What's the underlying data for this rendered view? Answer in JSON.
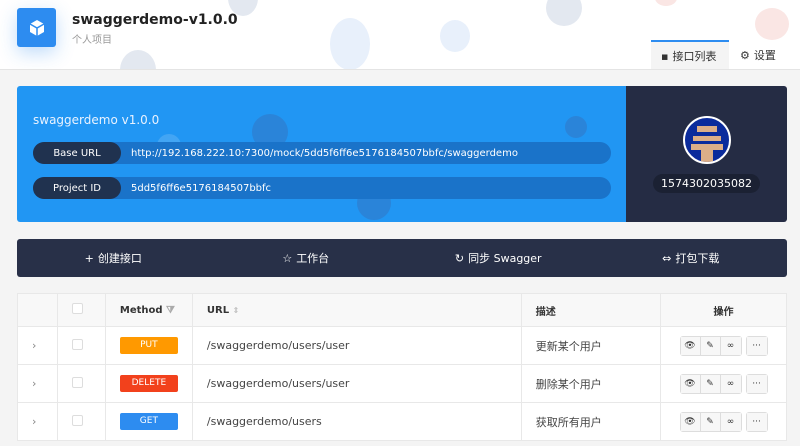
{
  "header": {
    "title": "swaggerdemo-v1.0.0",
    "subtitle": "个人项目",
    "tabs": [
      {
        "label": "接口列表",
        "icon": "list-icon"
      },
      {
        "label": "设置",
        "icon": "gear-icon"
      }
    ]
  },
  "project": {
    "name": "swaggerdemo v1.0.0",
    "base_url_label": "Base URL",
    "base_url": "http://192.168.222.10:7300/mock/5dd5f6ff6e5176184507bbfc/swaggerdemo",
    "project_id_label": "Project ID",
    "project_id": "5dd5f6ff6e5176184507bbfc"
  },
  "user": {
    "id": "1574302035082"
  },
  "actions": [
    "创建接口",
    "工作台",
    "同步 Swagger",
    "打包下载"
  ],
  "table": {
    "headers": {
      "method": "Method",
      "url": "URL",
      "desc": "描述",
      "ops": "操作"
    },
    "rows": [
      {
        "method": "PUT",
        "color": "#ff9900",
        "url": "/swaggerdemo/users/user",
        "desc": "更新某个用户"
      },
      {
        "method": "DELETE",
        "color": "#f2411c",
        "url": "/swaggerdemo/users/user",
        "desc": "删除某个用户"
      },
      {
        "method": "GET",
        "color": "#2d8cf0",
        "url": "/swaggerdemo/users",
        "desc": "获取所有用户"
      }
    ]
  }
}
